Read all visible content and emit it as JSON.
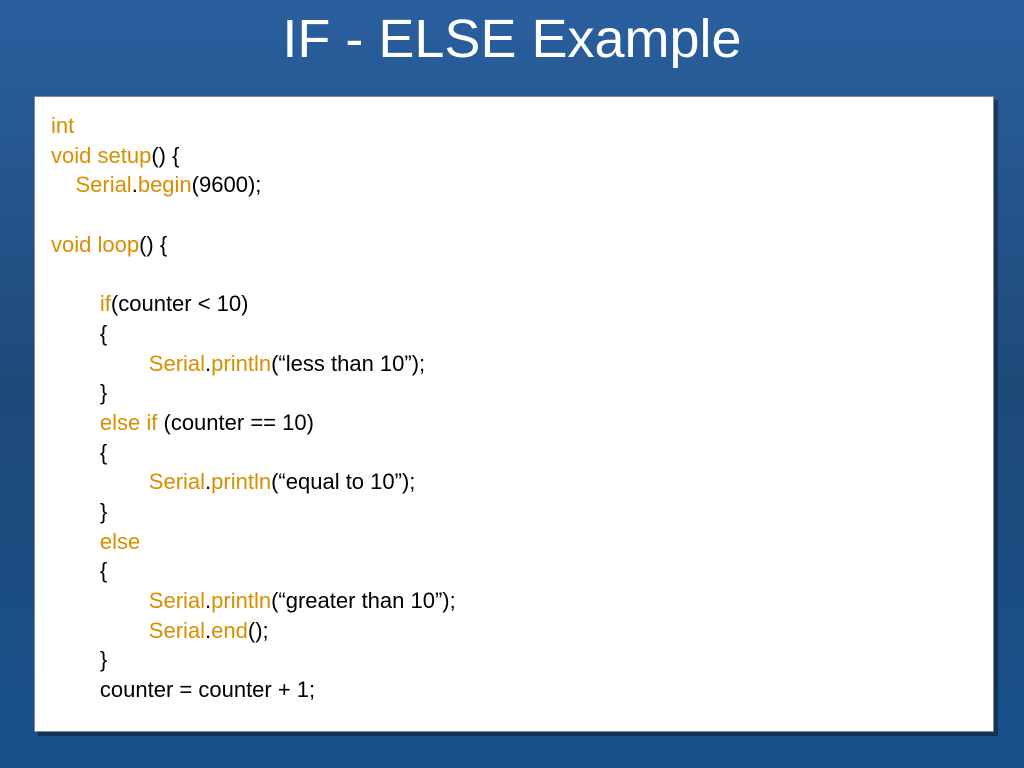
{
  "title": "IF - ELSE Example",
  "code": {
    "l1_kw": "int",
    "l2_kw": "void ",
    "l2_fn": "setup",
    "l2_rest": "() {",
    "l3_ind": "    ",
    "l3a": "Serial",
    "l3dot": ".",
    "l3b": "begin",
    "l3rest": "(9600);",
    "l5_kw": "void ",
    "l5_fn": "loop",
    "l5_rest": "() {",
    "ind2": "        ",
    "ind3": "                ",
    "if_kw": "if",
    "if_rest": "(counter < 10)",
    "ob": "{",
    "cb": "}",
    "sp_serial": "Serial",
    "dot": ".",
    "println": "println",
    "print1_rest": "(“less than 10”);",
    "elseif_kw": "else if ",
    "elseif_rest": "(counter == 10)",
    "print2_rest": "(“equal to 10”);",
    "else_kw": "else",
    "print3_rest": "(“greater than 10”);",
    "end_fn": "end",
    "end_rest": "();",
    "inc": "counter = counter + 1;"
  }
}
